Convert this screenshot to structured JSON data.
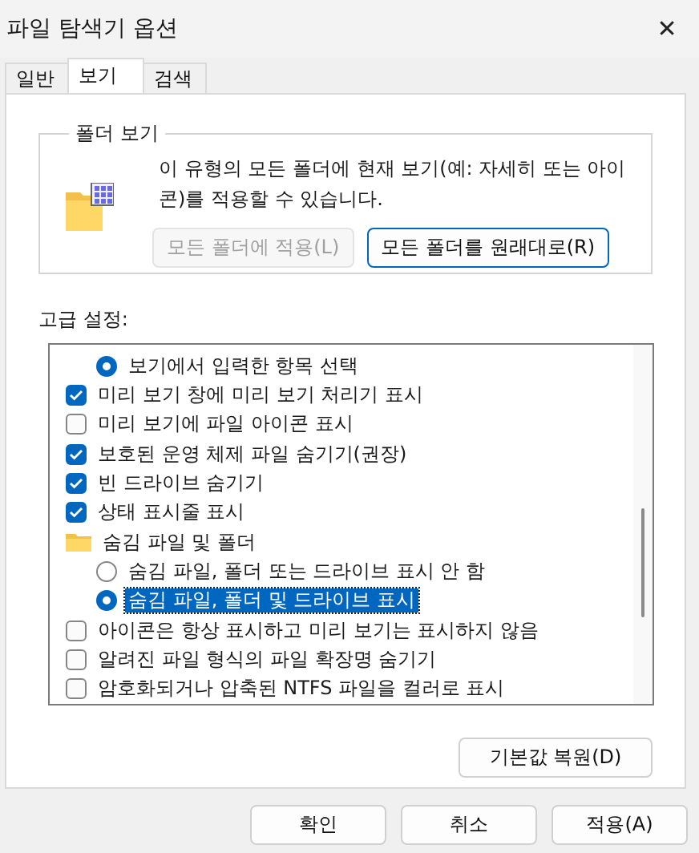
{
  "window": {
    "title": "파일 탐색기 옵션",
    "close": "✕"
  },
  "tabs": [
    {
      "label": "일반",
      "selected": false
    },
    {
      "label": "보기",
      "selected": true
    },
    {
      "label": "검색",
      "selected": false
    }
  ],
  "folder_view": {
    "title": "폴더 보기",
    "description": "이 유형의 모든 폴더에 현재 보기(예: 자세히 또는 아이콘)를 적용할 수 있습니다.",
    "buttons": [
      {
        "label": "모든 폴더에 적용(L)",
        "disabled": true
      },
      {
        "label": "모든 폴더를 원래대로(R)",
        "disabled": false
      }
    ]
  },
  "advanced": {
    "label": "고급 설정:",
    "items": [
      {
        "kind": "group",
        "children": [
          {
            "kind": "radio",
            "label": "보기에서 입력한 항목 선택",
            "checked": true,
            "selected": false
          }
        ]
      },
      {
        "kind": "checkbox",
        "label": "미리 보기 창에 미리 보기 처리기 표시",
        "checked": true,
        "selected": false
      },
      {
        "kind": "checkbox",
        "label": "미리 보기에 파일 아이콘 표시",
        "checked": false,
        "selected": false
      },
      {
        "kind": "checkbox",
        "label": "보호된 운영 체제 파일 숨기기(권장)",
        "checked": true,
        "selected": false
      },
      {
        "kind": "checkbox",
        "label": "빈 드라이브 숨기기",
        "checked": true,
        "selected": false
      },
      {
        "kind": "checkbox",
        "label": "상태 표시줄 표시",
        "checked": true,
        "selected": false
      },
      {
        "kind": "folder",
        "label": "숨김 파일 및 폴더",
        "children": [
          {
            "kind": "radio",
            "label": "숨김 파일, 폴더 또는 드라이브 표시 안 함",
            "checked": false,
            "selected": false
          },
          {
            "kind": "radio",
            "label": "숨김 파일, 폴더 및 드라이브 표시",
            "checked": true,
            "selected": true
          }
        ]
      },
      {
        "kind": "checkbox",
        "label": "아이콘은 항상 표시하고 미리 보기는 표시하지 않음",
        "checked": false,
        "selected": false
      },
      {
        "kind": "checkbox",
        "label": "알려진 파일 형식의 파일 확장명 숨기기",
        "checked": false,
        "selected": false
      },
      {
        "kind": "checkbox",
        "label": "암호화되거나 압축된 NTFS 파일을 컬러로 표시",
        "checked": false,
        "selected": false
      }
    ],
    "restore": "기본값 복원(D)"
  },
  "buttons": [
    "확인",
    "취소",
    "적용(A)"
  ]
}
